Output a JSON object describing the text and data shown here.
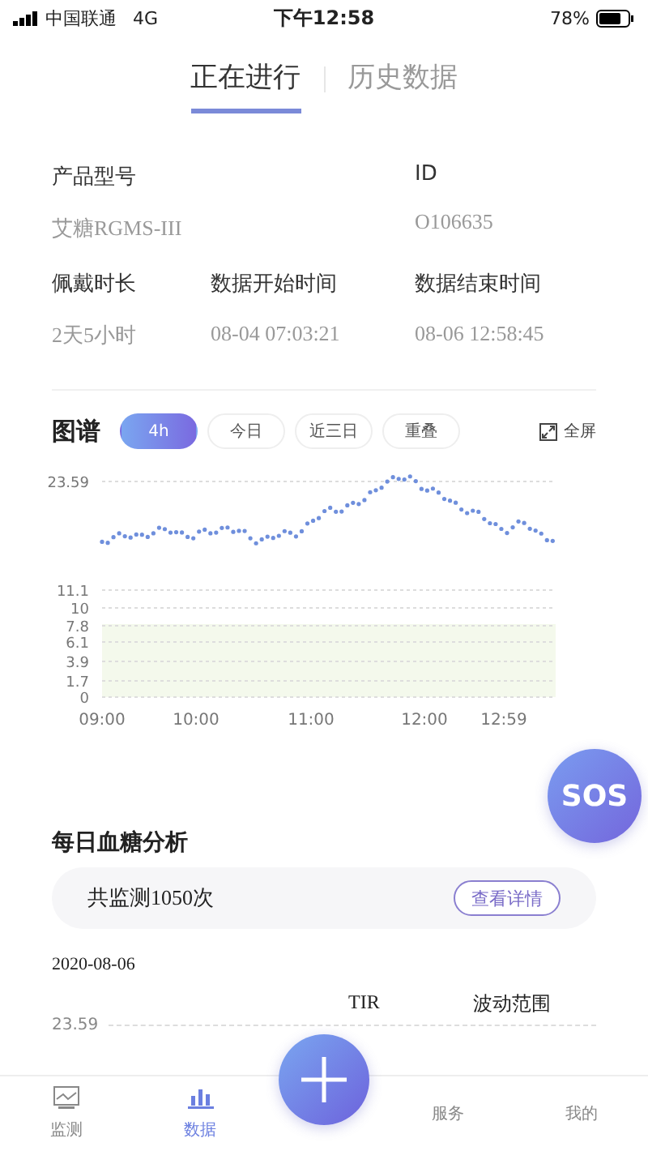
{
  "status_bar": {
    "carrier": "中国联通",
    "network": "4G",
    "time": "下午12:58",
    "battery": "78%"
  },
  "tabs": [
    {
      "label": "正在进行",
      "selected": true
    },
    {
      "label": "历史数据",
      "selected": false
    }
  ],
  "info": [
    {
      "label": "产品型号",
      "value": "艾糖RGMS-III"
    },
    {
      "label": "ID",
      "value": "O106635"
    },
    {
      "label": "佩戴时长",
      "value": "2天5小时"
    },
    {
      "label": "数据开始时间",
      "value": "08-04 07:03:21"
    },
    {
      "label": "数据结束时间",
      "value": "08-06 12:58:45"
    }
  ],
  "chart_section": {
    "title": "图谱",
    "ranges": [
      {
        "label": "4h",
        "selected": true
      },
      {
        "label": "今日",
        "selected": false
      },
      {
        "label": "近三日",
        "selected": false
      },
      {
        "label": "重叠",
        "selected": false
      }
    ],
    "fullscreen": "全屏",
    "y_labels": [
      "23.59",
      "11.1",
      "10",
      "7.8",
      "6.1",
      "3.9",
      "1.7",
      "0"
    ],
    "x_labels": [
      "09:00",
      "10:00",
      "11:00",
      "12:00",
      "12:59"
    ]
  },
  "sos": "SOS",
  "daily": {
    "title": "每日血糖分析",
    "count": "共监测1050次",
    "details_button": "查看详情",
    "date": "2020-08-06",
    "columns": [
      "TIR",
      "波动范围"
    ],
    "y_label": "23.59"
  },
  "nav": [
    {
      "label": "监测",
      "kind": "monitor",
      "selected": false
    },
    {
      "label": "数据",
      "kind": "bars",
      "selected": true
    },
    {
      "kind": "add"
    },
    {
      "label": "服务",
      "kind": "plain",
      "selected": false
    },
    {
      "label": "我的",
      "kind": "plain",
      "selected": false
    }
  ]
}
